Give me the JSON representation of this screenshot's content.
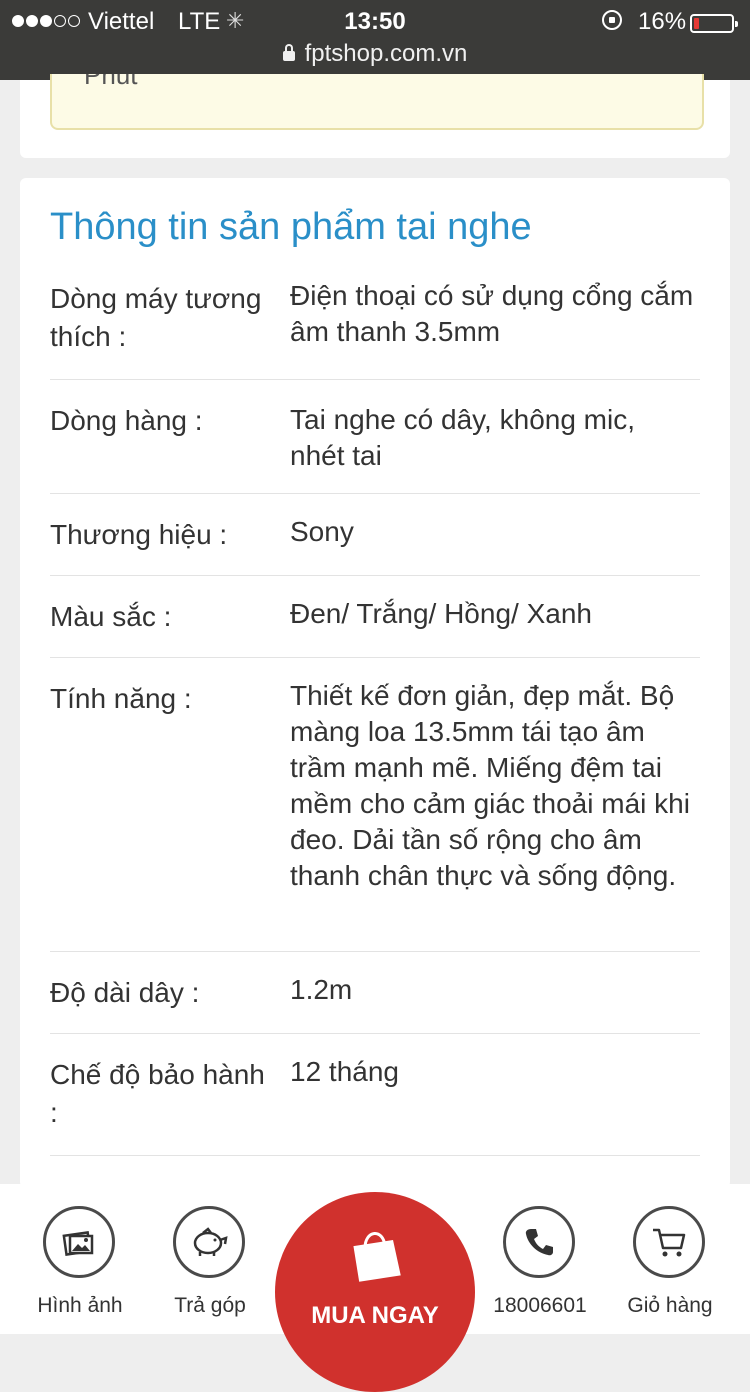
{
  "status_bar": {
    "carrier": "Viettel",
    "network": "LTE",
    "time": "13:50",
    "battery": "16%",
    "url": "fptshop.com.vn"
  },
  "notice": {
    "text": "Phút"
  },
  "spec": {
    "title": "Thông tin sản phẩm tai nghe",
    "rows": [
      {
        "label": "Dòng máy tương thích :",
        "value": "Điện thoại có sử dụng cổng cắm âm thanh 3.5mm"
      },
      {
        "label": "Dòng hàng :",
        "value": "Tai nghe có dây, không mic, nhét tai"
      },
      {
        "label": "Thương hiệu :",
        "value": "Sony"
      },
      {
        "label": "Màu sắc :",
        "value": "Đen/ Trắng/ Hồng/ Xanh"
      },
      {
        "label": "Tính năng :",
        "value": "Thiết kế đơn giản, đẹp mắt. Bộ màng loa 13.5mm tái tạo âm trầm mạnh mẽ. Miếng đệm tai mềm cho cảm giác thoải mái khi đeo. Dải tần số rộng cho âm thanh chân thực và sống động."
      },
      {
        "label": "Độ dài dây :",
        "value": "1.2m"
      },
      {
        "label": "Chế độ bảo hành :",
        "value": "12 tháng"
      }
    ]
  },
  "bottom_nav": {
    "images": "Hình ảnh",
    "installment": "Trả góp",
    "buy_now": "MUA NGAY",
    "hotline": "18006601",
    "cart": "Giỏ hàng"
  },
  "colors": {
    "title": "#2a8fc8",
    "buy_button": "#d0312d",
    "battery_low": "#e53935"
  }
}
